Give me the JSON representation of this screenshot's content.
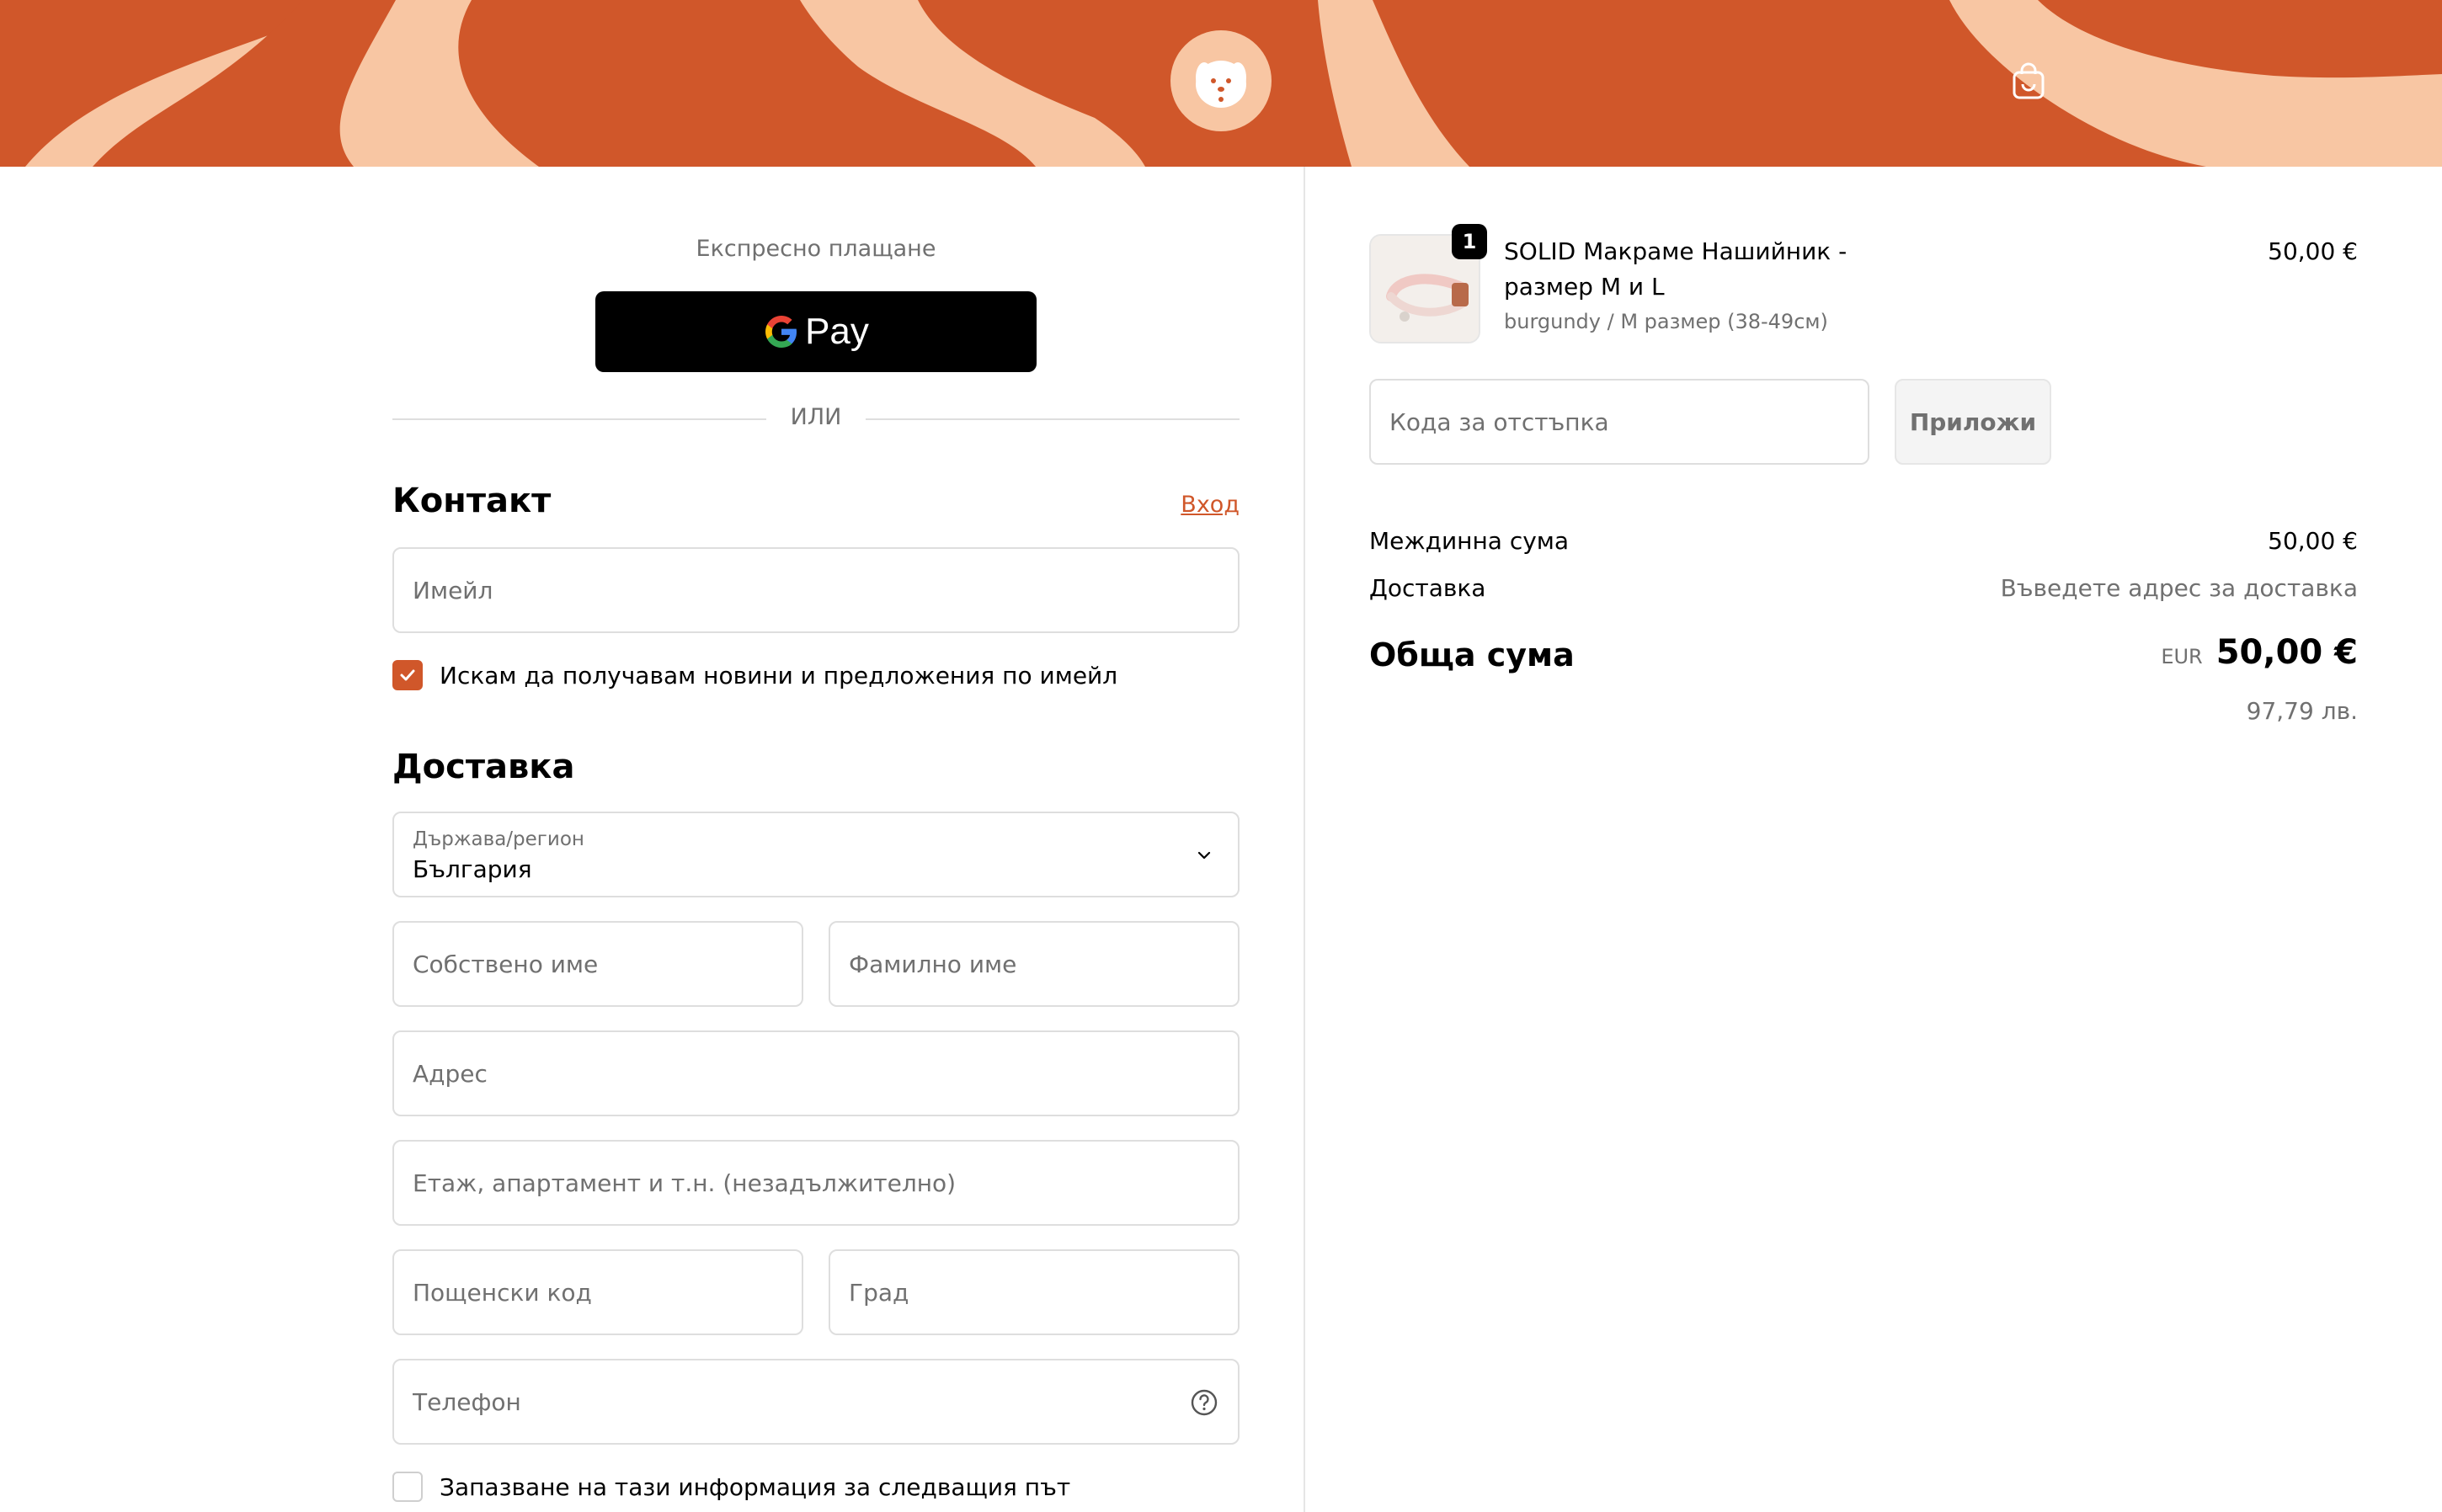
{
  "header": {
    "logo_icon": "dog-face-logo-icon",
    "cart_icon": "shopping-bag-icon",
    "background_color": "#d0572a",
    "pattern_color": "#f8c6a3"
  },
  "express": {
    "label": "Експресно плащане",
    "gpay_g": "G",
    "gpay_label": "Pay",
    "or_label": "ИЛИ"
  },
  "contact": {
    "heading": "Контакт",
    "login_link": "Вход",
    "email_placeholder": "Имейл",
    "newsletter_label": "Искам да получавам новини и предложения по имейл",
    "newsletter_checked": true
  },
  "delivery": {
    "heading": "Доставка",
    "country_label": "Държава/регион",
    "country_value": "България",
    "first_name_placeholder": "Собствено име",
    "last_name_placeholder": "Фамилно име",
    "address_placeholder": "Адрес",
    "apartment_placeholder": "Етаж, апартамент и т.н. (незадължително)",
    "postal_placeholder": "Пощенски код",
    "city_placeholder": "Град",
    "phone_placeholder": "Телефон",
    "help_icon": "question-circle-icon",
    "save_info_label": "Запазване на тази информация за следващия път",
    "save_info_checked": false
  },
  "summary": {
    "item": {
      "quantity": "1",
      "title": "SOLID Макраме Нашийник - размер М и L",
      "variant": "burgundy / M размер (38-49см)",
      "price": "50,00 €"
    },
    "discount_placeholder": "Кода за отстъпка",
    "apply_label": "Приложи",
    "subtotal_label": "Междинна сума",
    "subtotal_value": "50,00 €",
    "shipping_label": "Доставка",
    "shipping_value": "Въведете адрес за доставка",
    "total_label": "Обща сума",
    "currency": "EUR",
    "total_value": "50,00 €",
    "total_bgn": "97,79 лв."
  },
  "colors": {
    "accent": "#d0572a",
    "muted_text": "#707070",
    "border": "#dedede"
  }
}
